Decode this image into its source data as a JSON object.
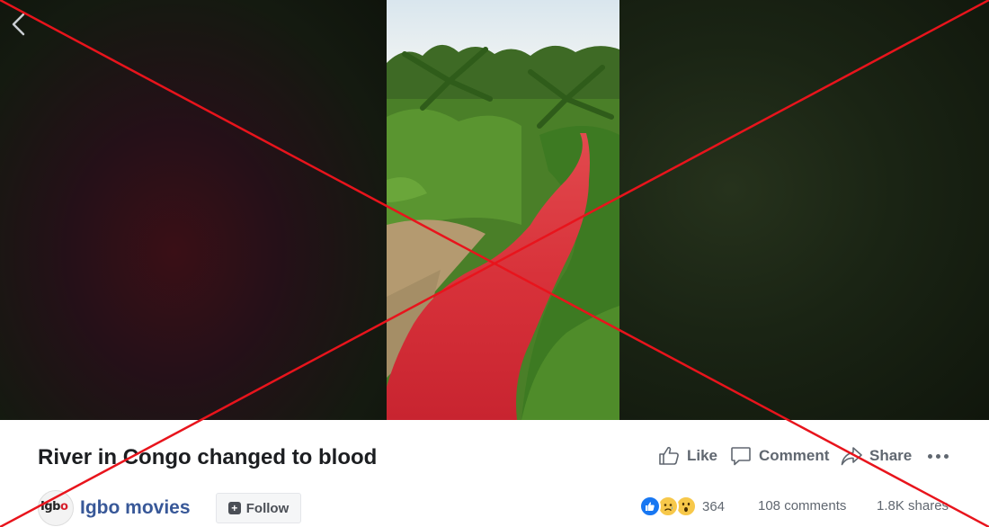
{
  "post": {
    "title": "River in Congo changed to blood"
  },
  "actions": {
    "like_label": "Like",
    "comment_label": "Comment",
    "share_label": "Share"
  },
  "page": {
    "name": "Igbo movies",
    "avatar_text_prefix": "Igb",
    "avatar_text_accent": "o",
    "follow_label": "Follow"
  },
  "stats": {
    "reaction_count": "364",
    "comments": "108 comments",
    "shares": "1.8K shares"
  },
  "icons": {
    "back": "chevron-left-icon",
    "like": "thumbs-up-icon",
    "comment": "speech-bubble-icon",
    "share": "share-arrow-icon",
    "more": "ellipsis-icon",
    "follow": "plus-square-icon"
  },
  "colors": {
    "page_name": "#385898",
    "cross": "#e8141c",
    "river": "#d8323a",
    "like_reaction": "#1877f2"
  }
}
